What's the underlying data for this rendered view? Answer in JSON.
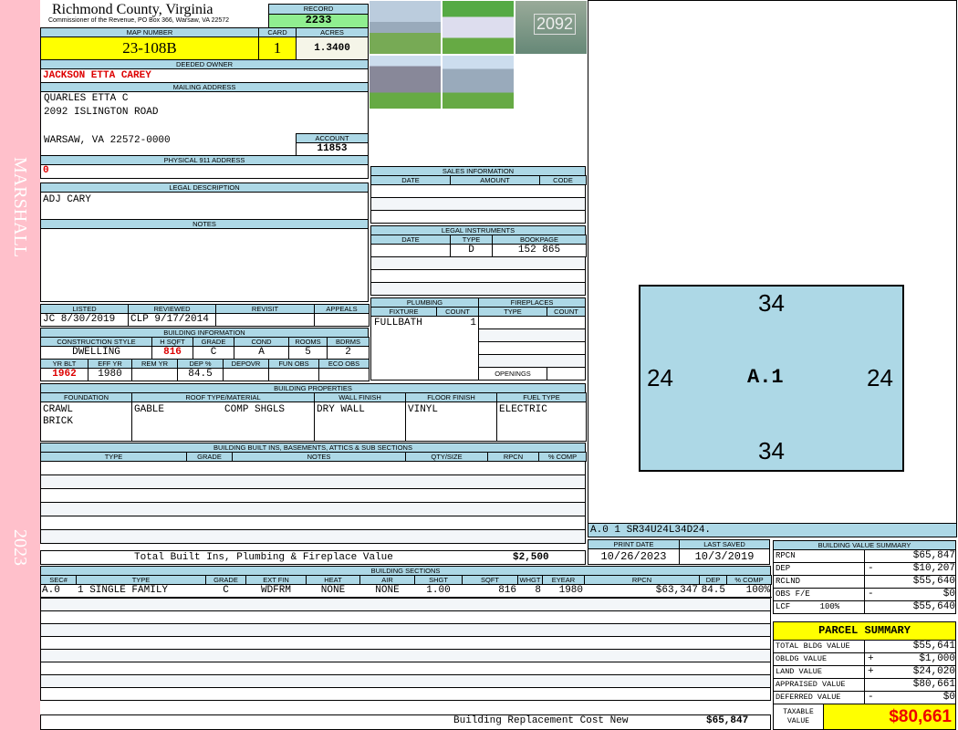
{
  "strip": {
    "name": "MARSHALL",
    "year": "2023"
  },
  "header": {
    "title": "Richmond County, Virginia",
    "subtitle": "Commissioner of the Revenue, PO Box 366, Warsaw, VA 22572",
    "record_label": "RECORD",
    "record": "2233",
    "map_label": "MAP NUMBER",
    "map": "23-108B",
    "card_label": "CARD",
    "card": "1",
    "acres_label": "ACRES",
    "acres": "1.3400"
  },
  "owner": {
    "label": "DEEDED OWNER",
    "name": "JACKSON ETTA CAREY"
  },
  "mailing": {
    "label": "MAILING ADDRESS",
    "line1": "QUARLES ETTA C",
    "line2": "2092 ISLINGTON ROAD",
    "line3": "WARSAW, VA 22572-0000",
    "account_label": "ACCOUNT",
    "account": "11853"
  },
  "physical": {
    "label": "PHYSICAL 911 ADDRESS",
    "value": "0"
  },
  "legal": {
    "label": "LEGAL DESCRIPTION",
    "value": "ADJ CARY"
  },
  "notes": {
    "label": "NOTES"
  },
  "photo_caption": "2092",
  "listing": {
    "listed_label": "LISTED",
    "listed": "JC      8/30/2019",
    "reviewed_label": "REVIEWED",
    "reviewed": "CLP   9/17/2014",
    "revisit_label": "REVISIT",
    "appeals_label": "APPEALS"
  },
  "building_info": {
    "label": "BUILDING INFORMATION",
    "cols1": [
      "CONSTRUCTION STYLE",
      "H SQFT",
      "GRADE",
      "COND",
      "ROOMS",
      "BDRMS"
    ],
    "vals1": [
      "DWELLING",
      "816",
      "C",
      "A",
      "5",
      "2"
    ],
    "cols2": [
      "YR BLT",
      "EFF YR",
      "REM YR",
      "DEP %",
      "DEPOVR",
      "FUN OBS",
      "ECO OBS"
    ],
    "vals2": [
      "1962",
      "1980",
      "",
      "84.5",
      "",
      "",
      ""
    ]
  },
  "properties": {
    "label": "BUILDING PROPERTIES",
    "cols": [
      "FOUNDATION",
      "ROOF TYPE/MATERIAL",
      "WALL FINISH",
      "FLOOR FINISH",
      "FUEL TYPE"
    ],
    "foundation": "CRAWL\nBRICK",
    "roof": "GABLE          COMP SHGLS",
    "wall": "DRY WALL",
    "floor": "VINYL",
    "fuel": "ELECTRIC"
  },
  "builtins": {
    "label": "BUILDING BUILT INS, BASEMENTS, ATTICS & SUB SECTIONS",
    "cols": [
      "TYPE",
      "GRADE",
      "NOTES",
      "QTY/SIZE",
      "RPCN",
      "% COMP"
    ],
    "total_label": "Total Built Ins, Plumbing & Fireplace Value",
    "total": "$2,500"
  },
  "sales": {
    "label": "SALES INFORMATION",
    "cols": [
      "DATE",
      "AMOUNT",
      "CODE"
    ]
  },
  "instruments": {
    "label": "LEGAL INSTRUMENTS",
    "cols": [
      "DATE",
      "TYPE",
      "BOOKPAGE"
    ],
    "rows": [
      [
        "",
        "D",
        "152 865"
      ]
    ]
  },
  "plumbing": {
    "label": "PLUMBING",
    "cols": [
      "FIXTURE",
      "COUNT"
    ],
    "rows": [
      [
        "FULLBATH",
        "1"
      ]
    ]
  },
  "fireplaces": {
    "label": "FIREPLACES",
    "cols": [
      "TYPE",
      "COUNT"
    ],
    "openings": "OPENINGS"
  },
  "sketch": {
    "top": "34",
    "bottom": "34",
    "left": "24",
    "right": "24",
    "label": "A.1",
    "code": "A.0   1     SR34U24L34D24."
  },
  "dates": {
    "print_label": "PRINT DATE",
    "print": "10/26/2023",
    "saved_label": "LAST SAVED",
    "saved": "10/3/2019"
  },
  "sections": {
    "label": "BUILDING SECTIONS",
    "cols": [
      "SEC#",
      "TYPE",
      "GRADE",
      "EXT FIN",
      "HEAT",
      "AIR",
      "SHGT",
      "SQFT",
      "WHGT",
      "EYEAR",
      "RPCN",
      "DEP",
      "% COMP"
    ],
    "rows": [
      [
        "A.0",
        "1 SINGLE FAMILY",
        "C",
        "WDFRM",
        "NONE",
        "NONE",
        "1.00",
        "816",
        "8",
        "1980",
        "$63,347",
        "84.5",
        "100%"
      ]
    ],
    "rcn_label": "Building Replacement Cost New",
    "rcn": "$65,847"
  },
  "value_summary": {
    "label": "BUILDING VALUE SUMMARY",
    "rows": [
      [
        "RPCN",
        "",
        "$65,847"
      ],
      [
        "DEP",
        "-",
        "$10,207"
      ],
      [
        "RCLND",
        "",
        "$55,640"
      ],
      [
        "OBS F/E",
        "-",
        "$0"
      ],
      [
        "LCF      100%",
        "",
        "$55,640"
      ]
    ]
  },
  "parcel": {
    "label": "PARCEL SUMMARY",
    "rows": [
      [
        "TOTAL BLDG VALUE",
        "",
        "$55,641"
      ],
      [
        "OBLDG VALUE",
        "+",
        "$1,000"
      ],
      [
        "LAND VALUE",
        "+",
        "$24,020"
      ],
      [
        "APPRAISED VALUE",
        "",
        "$80,661"
      ],
      [
        "DEFERRED VALUE",
        "-",
        "$0"
      ]
    ],
    "taxable_label": "TAXABLE VALUE",
    "taxable": "$80,661"
  },
  "colors": {
    "header": "#add8e6",
    "highlight": "#ffff00",
    "record": "#90ee90",
    "strip": "#ffc0cb",
    "sketch": "#add8e6"
  }
}
